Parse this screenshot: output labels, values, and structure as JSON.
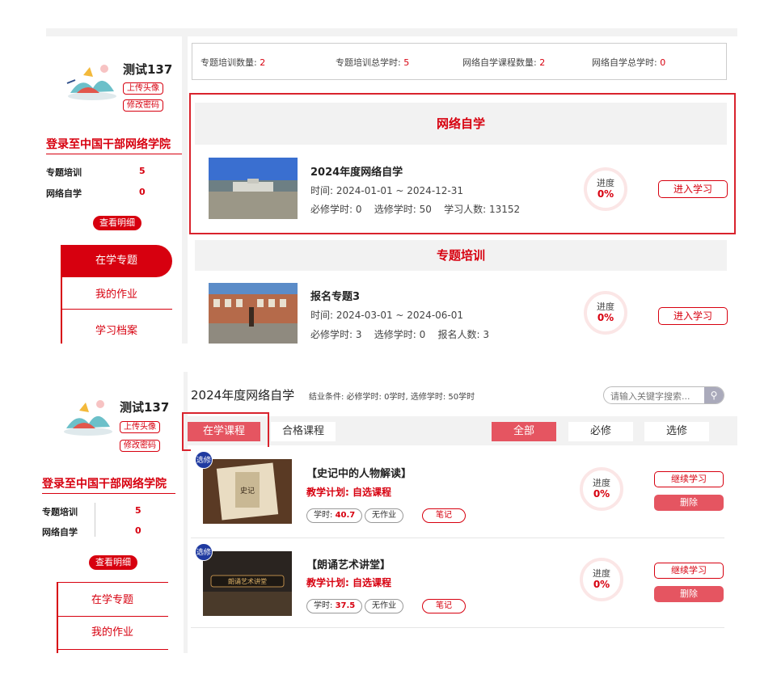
{
  "top": {
    "user": {
      "name": "测试137",
      "upload_avatar": "上传头像",
      "change_password": "修改密码"
    },
    "login_title": "登录至中国干部网络学院",
    "stats": [
      {
        "label": "专题培训",
        "value": "5"
      },
      {
        "label": "网络自学",
        "value": "0"
      }
    ],
    "detail_btn": "查看明细",
    "nav": [
      "在学专题",
      "我的作业",
      "学习档案"
    ],
    "summary": [
      {
        "label": "专题培训数量:",
        "value": "2"
      },
      {
        "label": "专题培训总学时:",
        "value": "5"
      },
      {
        "label": "网络自学课程数量:",
        "value": "2"
      },
      {
        "label": "网络自学总学时:",
        "value": "0"
      }
    ],
    "section_online": "网络自学",
    "course1": {
      "title": "2024年度网络自学",
      "time": "时间: 2024-01-01 ~ 2024-12-31",
      "meta": "必修学时: 0    选修学时: 50    学习人数: 13152",
      "progress_label": "进度",
      "progress": "0%",
      "enter": "进入学习"
    },
    "section_topic": "专题培训",
    "course2": {
      "title": "报名专题3",
      "time": "时间: 2024-03-01 ~ 2024-06-01",
      "meta": "必修学时: 3    选修学时: 0    报名人数: 3",
      "progress_label": "进度",
      "progress": "0%",
      "enter": "进入学习"
    }
  },
  "bottom": {
    "user": {
      "name": "测试137",
      "upload_avatar": "上传头像",
      "change_password": "修改密码"
    },
    "login_title": "登录至中国干部网络学院",
    "stats": [
      {
        "label": "专题培训",
        "value": "5"
      },
      {
        "label": "网络自学",
        "value": "0"
      }
    ],
    "detail_btn": "查看明细",
    "nav": [
      "在学专题",
      "我的作业"
    ],
    "header_title": "2024年度网络自学",
    "header_cond": "结业条件: 必修学时: 0学时, 选修学时: 50学时",
    "search_placeholder": "请输入关键字搜索...",
    "tabs": {
      "studying": "在学课程",
      "passed": "合格课程"
    },
    "filters": [
      "全部",
      "必修",
      "选修"
    ],
    "courses": [
      {
        "badge": "选修",
        "title": "【史记中的人物解读】",
        "plan": "教学计划: 自选课程",
        "hours_label": "学时:",
        "hours": "40.7",
        "homework": "无作业",
        "notes": "笔记",
        "progress_label": "进度",
        "progress": "0%",
        "continue": "继续学习",
        "delete": "删除"
      },
      {
        "badge": "选修",
        "title": "【朗诵艺术讲堂】",
        "plan": "教学计划: 自选课程",
        "hours_label": "学时:",
        "hours": "37.5",
        "homework": "无作业",
        "notes": "笔记",
        "progress_label": "进度",
        "progress": "0%",
        "continue": "继续学习",
        "delete": "删除"
      }
    ]
  },
  "colors": {
    "accent": "#d7000f",
    "soft_red": "#e55561",
    "badge_blue": "#1f3aa0"
  }
}
